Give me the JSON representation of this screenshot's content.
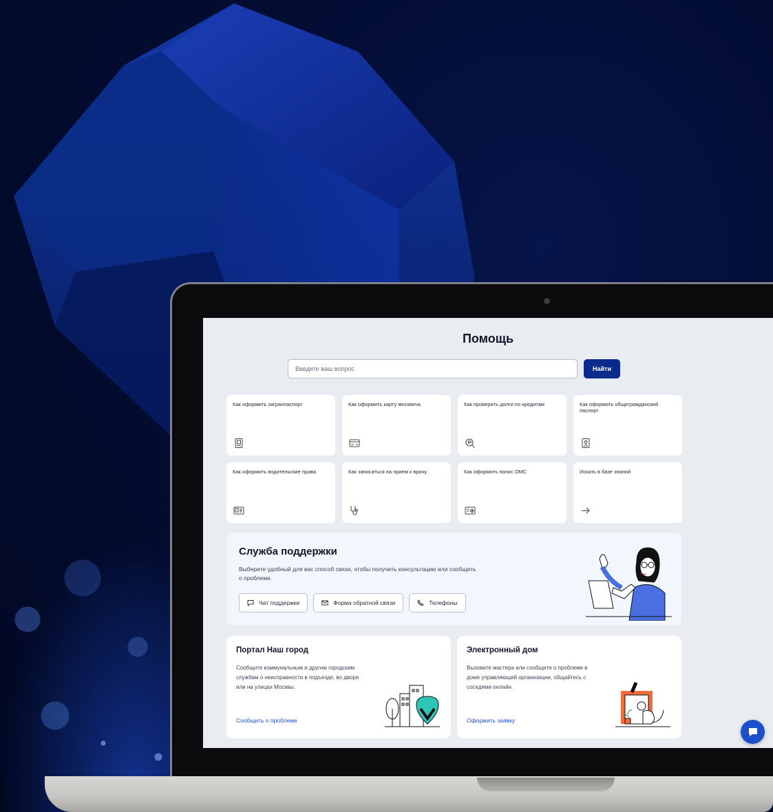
{
  "help": {
    "title": "Помощь",
    "search": {
      "placeholder": "Введите ваш вопрос",
      "button": "Найти"
    },
    "quick_links": [
      {
        "label": "Как оформить загранпаспорт",
        "icon": "passport-icon"
      },
      {
        "label": "Как оформить карту москвича",
        "icon": "card-icon"
      },
      {
        "label": "Как проверить долги по кредитам",
        "icon": "search-money-icon"
      },
      {
        "label": "Как оформить общегражданский паспорт",
        "icon": "passport-emblem-icon"
      },
      {
        "label": "Как оформить водительские права",
        "icon": "driver-license-icon"
      },
      {
        "label": "Как записаться на прием к врачу",
        "icon": "stethoscope-icon"
      },
      {
        "label": "Как оформить полис ОМС",
        "icon": "medical-card-icon"
      },
      {
        "label": "Искать в базе знаний",
        "icon": "arrow-right-icon"
      }
    ],
    "support": {
      "title": "Служба поддержки",
      "description": "Выберите удобный для вас способ связи, чтобы получить консультацию или сообщить о проблеме.",
      "buttons": [
        {
          "label": "Чат поддержки",
          "icon": "chat-icon"
        },
        {
          "label": "Форма обратной связи",
          "icon": "mail-icon"
        },
        {
          "label": "Телефоны",
          "icon": "phone-icon"
        }
      ]
    },
    "services": [
      {
        "title": "Портал Наш город",
        "description": "Сообщите коммунальным и другим городским службам о неисправности в подъезде, во дворе или на улицах Москвы.",
        "link": "Сообщить о проблеме"
      },
      {
        "title": "Электронный дом",
        "description": "Вызовите мастера или сообщите о проблеме в доме управляющей организации, общайтесь с соседями онлайн.",
        "link": "Оформить заявку"
      }
    ]
  },
  "colors": {
    "primary": "#0a2a8c",
    "link": "#1d4ed8",
    "screen_bg": "#e9ecf1",
    "support_bg": "#f2f6fd",
    "accent_teal": "#2ec4b6",
    "accent_orange": "#f26b3a"
  }
}
